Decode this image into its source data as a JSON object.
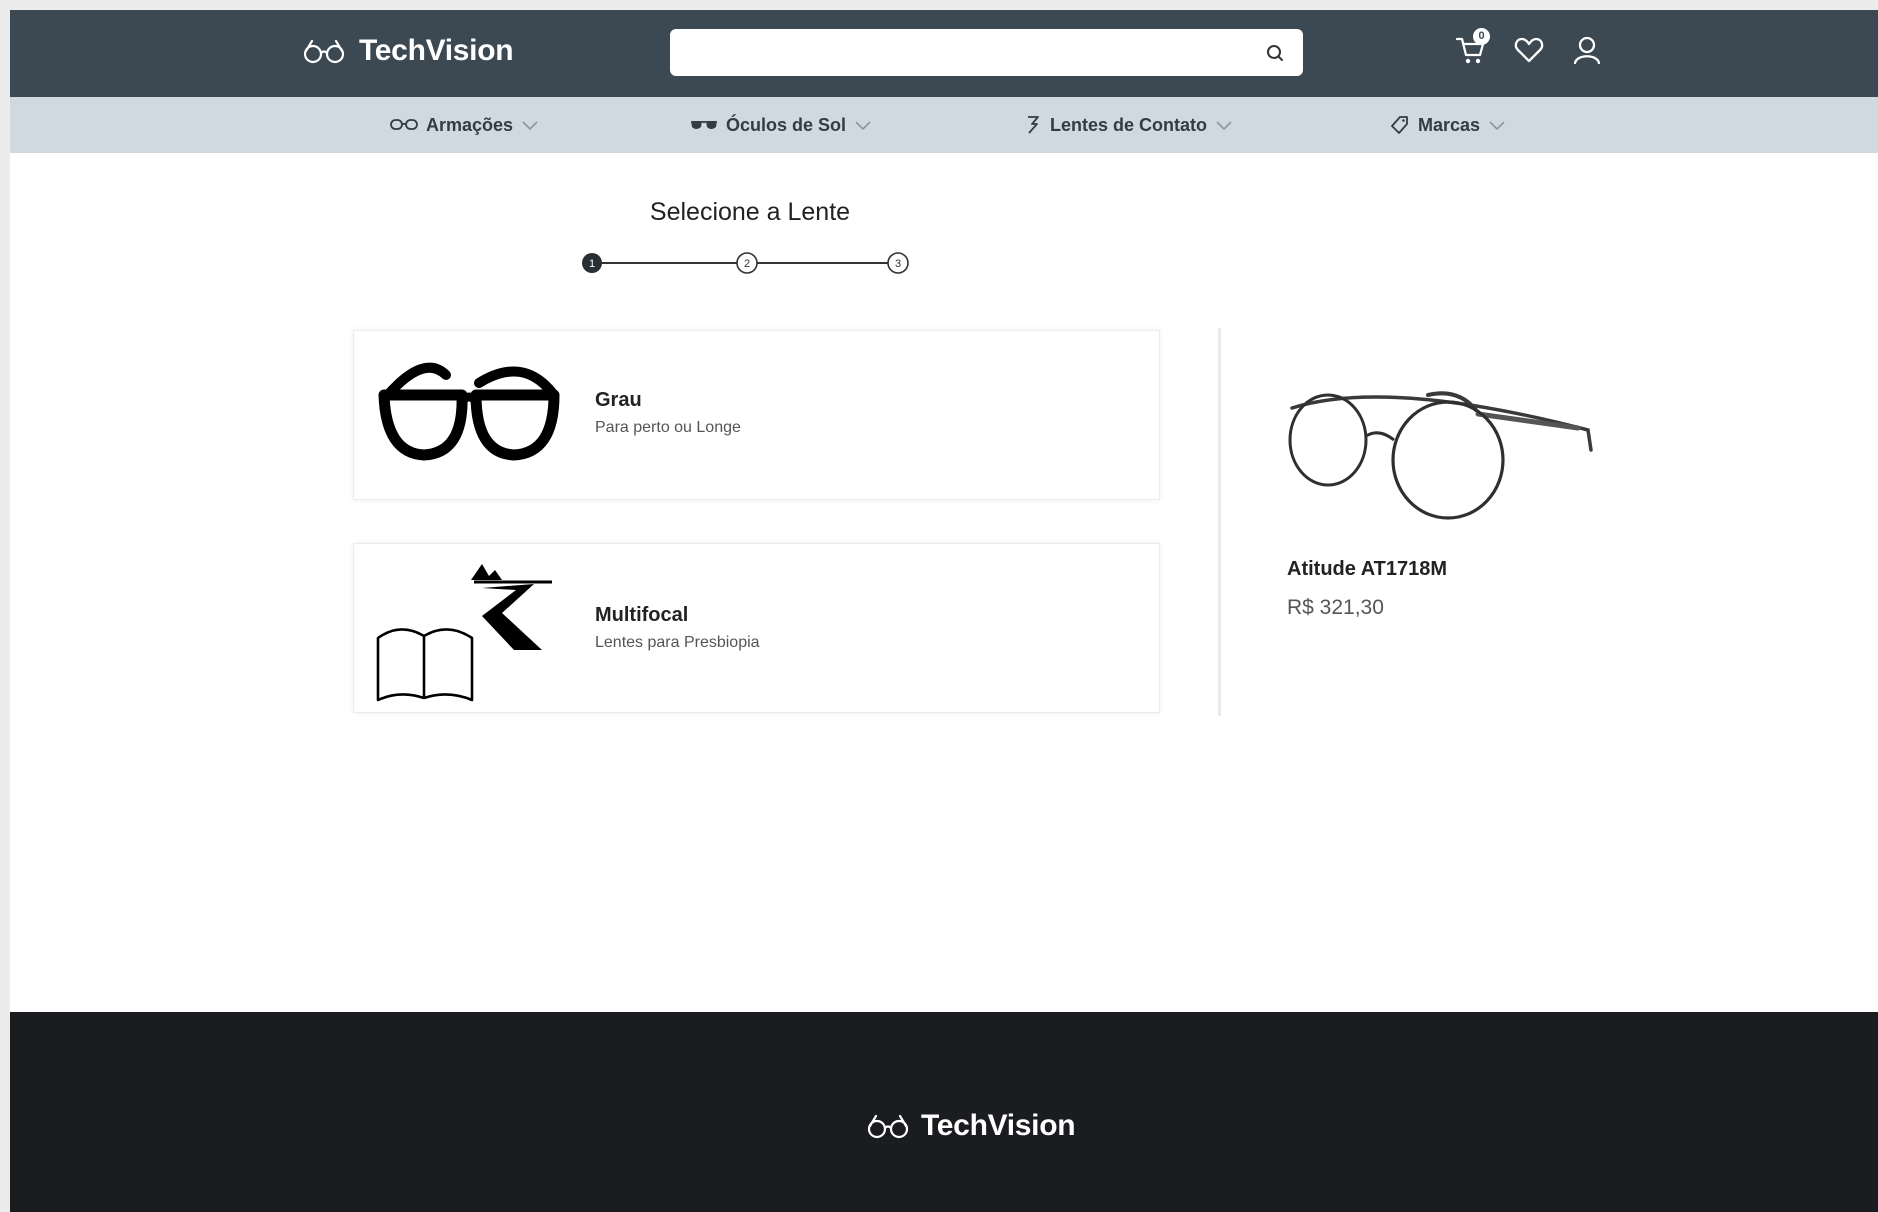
{
  "header": {
    "brand": "TechVision",
    "search": {
      "value": "",
      "placeholder": ""
    },
    "cart_count": "0"
  },
  "categories": [
    {
      "label": "Armações",
      "icon": "eyeglasses-outline-icon"
    },
    {
      "label": "Óculos de Sol",
      "icon": "sunglasses-icon"
    },
    {
      "label": "Lentes de Contato",
      "icon": "contact-lens-icon"
    },
    {
      "label": "Marcas",
      "icon": "tag-icon"
    }
  ],
  "step": {
    "title": "Selecione a Lente",
    "labels": [
      "1",
      "2",
      "3"
    ],
    "current": 1
  },
  "options": [
    {
      "title": "Grau",
      "subtitle": "Para perto ou Longe",
      "icon": "reading-glasses-icon"
    },
    {
      "title": "Multifocal",
      "subtitle": "Lentes para Presbiopia",
      "icon": "book-and-road-icon"
    }
  ],
  "product": {
    "name": "Atitude AT1718M",
    "price": "R$ 321,30"
  },
  "footer": {
    "brand": "TechVision"
  },
  "colors": {
    "header_bg": "#3c4852",
    "nav_bg": "#d0d8e0",
    "footer_bg": "#1b1c20",
    "text_dark": "#222222"
  }
}
